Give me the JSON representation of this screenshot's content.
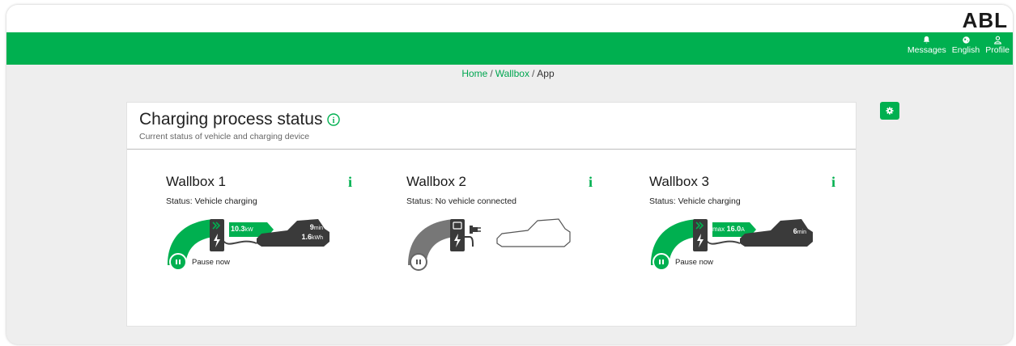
{
  "brand": {
    "logo": "ABL",
    "accent": "#00b050"
  },
  "nav": {
    "messages": "Messages",
    "language": "English",
    "profile": "Profile"
  },
  "breadcrumb": {
    "home": "Home",
    "wallbox": "Wallbox",
    "current": "App"
  },
  "card": {
    "title": "Charging process status",
    "subtitle": "Current status of vehicle and charging device"
  },
  "wallboxes": [
    {
      "title": "Wallbox 1",
      "status": "Status: Vehicle charging",
      "power_value": "10.3",
      "power_unit": "kW",
      "time_value": "9",
      "time_unit": "min",
      "energy_value": "1.6",
      "energy_unit": "kWh",
      "pause_label": "Pause now"
    },
    {
      "title": "Wallbox 2",
      "status": "Status: No vehicle connected"
    },
    {
      "title": "Wallbox 3",
      "status": "Status: Vehicle charging",
      "current_prefix": "max",
      "current_value": "16.0",
      "current_unit": "A",
      "time_value": "6",
      "time_unit": "min",
      "pause_label": "Pause now"
    }
  ]
}
